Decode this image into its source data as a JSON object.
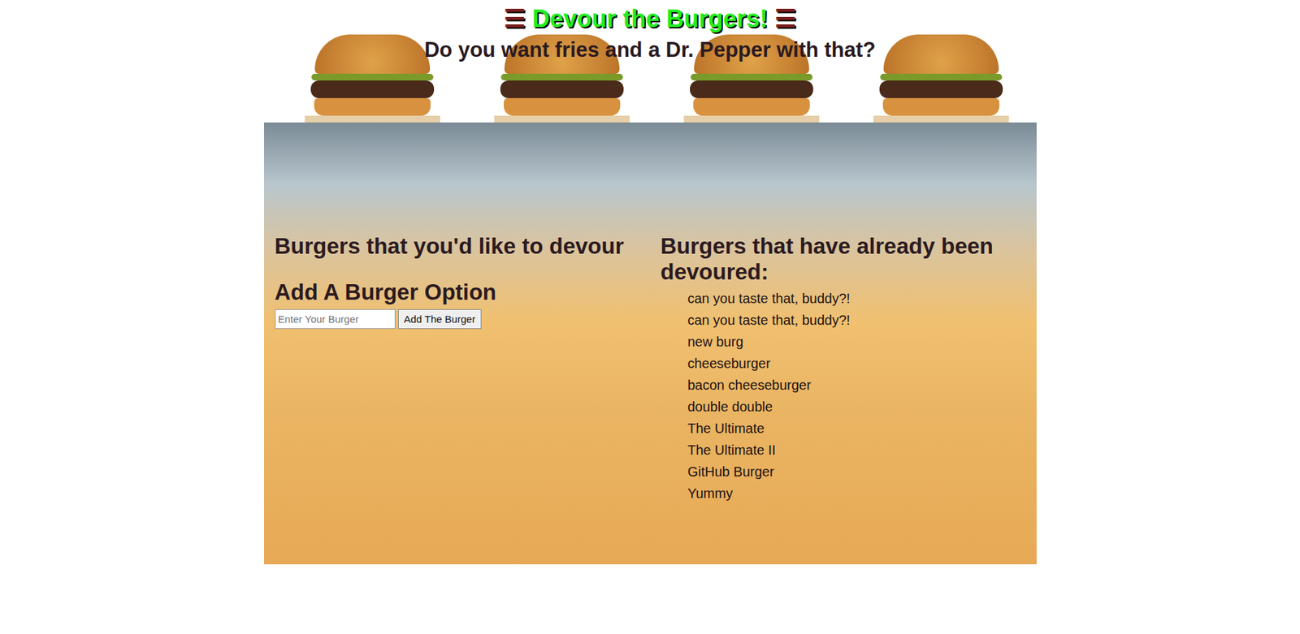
{
  "header": {
    "icon": "☰",
    "title": "Devour the Burgers!",
    "subtitle": "Do you want fries and a Dr. Pepper with that?"
  },
  "to_devour": {
    "heading": "Burgers that you'd like to devour",
    "items": []
  },
  "add_form": {
    "heading": "Add A Burger Option",
    "placeholder": "Enter Your Burger",
    "button": "Add The Burger"
  },
  "devoured": {
    "heading": "Burgers that have already been devoured:",
    "items": [
      "can you taste that, buddy?!",
      "can you taste that, buddy?!",
      "new burg",
      "cheeseburger",
      "bacon cheeseburger",
      "double double",
      "The Ultimate",
      "The Ultimate II",
      "GitHub Burger",
      "Yummy"
    ]
  }
}
